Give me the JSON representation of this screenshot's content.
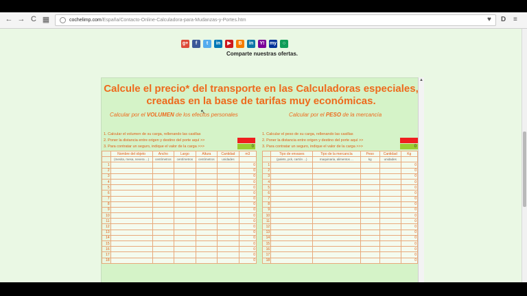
{
  "browser": {
    "url_host": "cochelimp.com",
    "url_path": "/España/Contacto-Online-Calculadora-para-Mudanzas-y-Portes.htm",
    "back": "←",
    "forward": "→",
    "reload": "C",
    "menu": "≡"
  },
  "social": {
    "share_text": "Comparte nuestras ofertas.",
    "icons": [
      "google-plus-icon",
      "facebook-icon",
      "twitter-icon",
      "linkedin-icon",
      "youtube-icon",
      "blogger-icon",
      "linkedin-in-icon",
      "yahoo-icon",
      "myspace-icon",
      "hangouts-icon"
    ],
    "colors": [
      "#dd4b39",
      "#3b5998",
      "#55acee",
      "#0077b5",
      "#cc181e",
      "#f57d00",
      "#0e76a8",
      "#7b0099",
      "#003399",
      "#0f9d58"
    ]
  },
  "panel": {
    "title_line1": "Calcule el precio* del transporte en las Calculadoras especiales,",
    "title_line2": "creadas en la base de tarifas muy económicas.",
    "left_sub_pre": "Calcular por el ",
    "left_sub_key": "VOLUMEN",
    "left_sub_post": " de los efectos personales",
    "right_sub_pre": "Calcular por el ",
    "right_sub_key": "PESO",
    "right_sub_post": " de la mercancía",
    "left_steps": [
      "1. Calcular el volumen de su carga, rellenando las casillas",
      "2. Poner la distancia entre origen y destino del porte aquí >>",
      "3. Para contratar un seguro, indique el valor de la carga >>>"
    ],
    "right_steps": [
      "1. Calcular el peso de su carga, rellenando las casillas",
      "2. Poner la distancia entre origen y destino del porte aquí >>",
      "3. Para contratar un seguro, indique el valor de la carga >>>"
    ],
    "left_insurance_value": "0",
    "right_insurance_value": "0",
    "left_headers": [
      "Nombre del objeto",
      "Ancho",
      "Largo",
      "Altura",
      "Cantidad",
      "m3"
    ],
    "left_subheaders": [
      "(mesita, mesa, nevera ...)",
      "centímetros",
      "centímetros",
      "centímetros",
      "unidades",
      ""
    ],
    "right_headers": [
      "Tipo de envases",
      "Tipo de la mercancía",
      "Peso",
      "Cantidad",
      "Kg"
    ],
    "right_subheaders": [
      "(palets, pck, cartón ...)",
      "maquinaria, alimentos ...",
      "kg",
      "unidades",
      ""
    ],
    "row_numbers": [
      "1",
      "2",
      "3",
      "4",
      "5",
      "6",
      "7",
      "8",
      "9",
      "10",
      "11",
      "12",
      "13",
      "14",
      "15",
      "16",
      "17",
      "18"
    ],
    "zero": "0"
  }
}
